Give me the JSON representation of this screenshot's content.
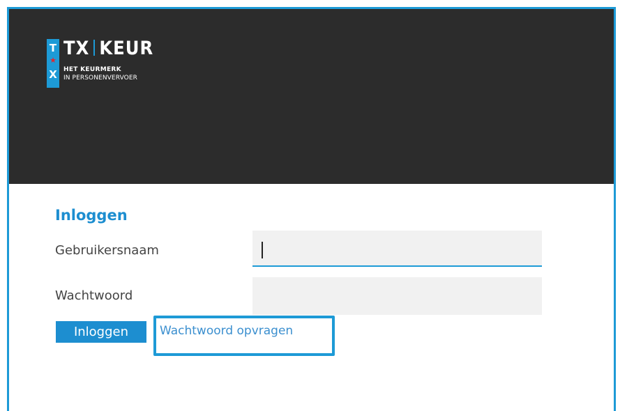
{
  "brand": {
    "badge_top": "T",
    "badge_star": "★",
    "badge_bottom": "X",
    "word_left": "TX",
    "word_right": "KEUR",
    "tagline_1": "HET KEURMERK",
    "tagline_2": "IN PERSONENVERVOER"
  },
  "login": {
    "title": "Inloggen",
    "username_label": "Gebruikersnaam",
    "username_value": "",
    "password_label": "Wachtwoord",
    "password_value": "",
    "submit_label": "Inloggen",
    "forgot_label": "Wachtwoord opvragen"
  },
  "colors": {
    "accent": "#1d9ad6",
    "header_bg": "#2c2c2c",
    "star": "#e2262e"
  }
}
